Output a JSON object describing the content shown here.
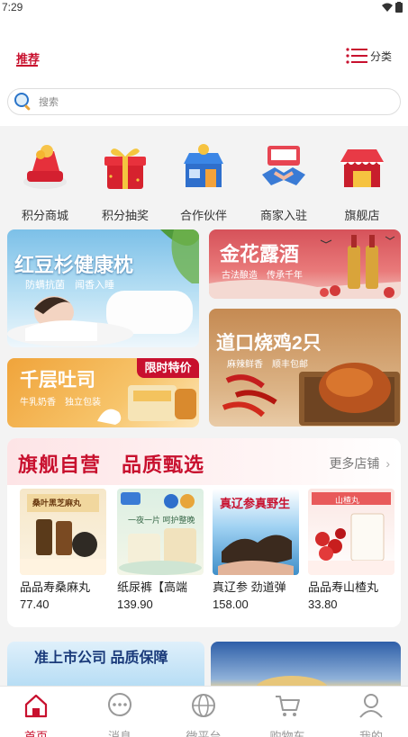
{
  "status_bar": {
    "time": "7:29"
  },
  "header": {
    "tab_label": "推荐",
    "category_label": "分类",
    "search_placeholder": "搜索"
  },
  "icon_grid": [
    {
      "label": "积分商城",
      "icon": "points-mall-icon"
    },
    {
      "label": "积分抽奖",
      "icon": "gift-box-icon"
    },
    {
      "label": "合作伙伴",
      "icon": "storefront-icon"
    },
    {
      "label": "商家入驻",
      "icon": "handshake-icon"
    },
    {
      "label": "旗舰店",
      "icon": "flagship-store-icon"
    }
  ],
  "banners": {
    "pillow": {
      "title": "红豆杉健康枕",
      "subtitle": "防螨抗菌　闻香入睡"
    },
    "liquor": {
      "title": "金花露酒",
      "subtitle": "古法酿造　传承千年"
    },
    "chicken": {
      "title": "道口烧鸡2只",
      "subtitle": "麻辣鲜香　顺丰包邮"
    },
    "toast": {
      "title": "千层吐司",
      "tag": "限时特价",
      "subtitle": "牛乳奶香　独立包装"
    }
  },
  "flagship": {
    "title": "旗舰自营　品质甄选",
    "more_label": "更多店铺",
    "products": [
      {
        "name": "品品寿桑麻丸",
        "price": "77.40",
        "img_text": "桑叶黑芝麻丸"
      },
      {
        "name": "纸尿裤【高端",
        "price": "139.90",
        "img_text": "一夜一片 呵护整晚"
      },
      {
        "name": "真辽参 劲道弹",
        "price": "158.00",
        "img_text": "真辽参真野生"
      },
      {
        "name": "品品寿山楂丸",
        "price": "33.80",
        "img_text": "山楂丸"
      }
    ]
  },
  "bottom_banners": {
    "left_text": "准上市公司 品质保障"
  },
  "tabbar": [
    {
      "label": "首页",
      "icon": "home-icon",
      "active": true
    },
    {
      "label": "消息",
      "icon": "message-icon",
      "active": false
    },
    {
      "label": "微平台",
      "icon": "globe-icon",
      "active": false
    },
    {
      "label": "购物车",
      "icon": "cart-icon",
      "active": false
    },
    {
      "label": "我的",
      "icon": "user-icon",
      "active": false
    }
  ],
  "colors": {
    "accent": "#c8102e",
    "inactive": "#999999"
  }
}
